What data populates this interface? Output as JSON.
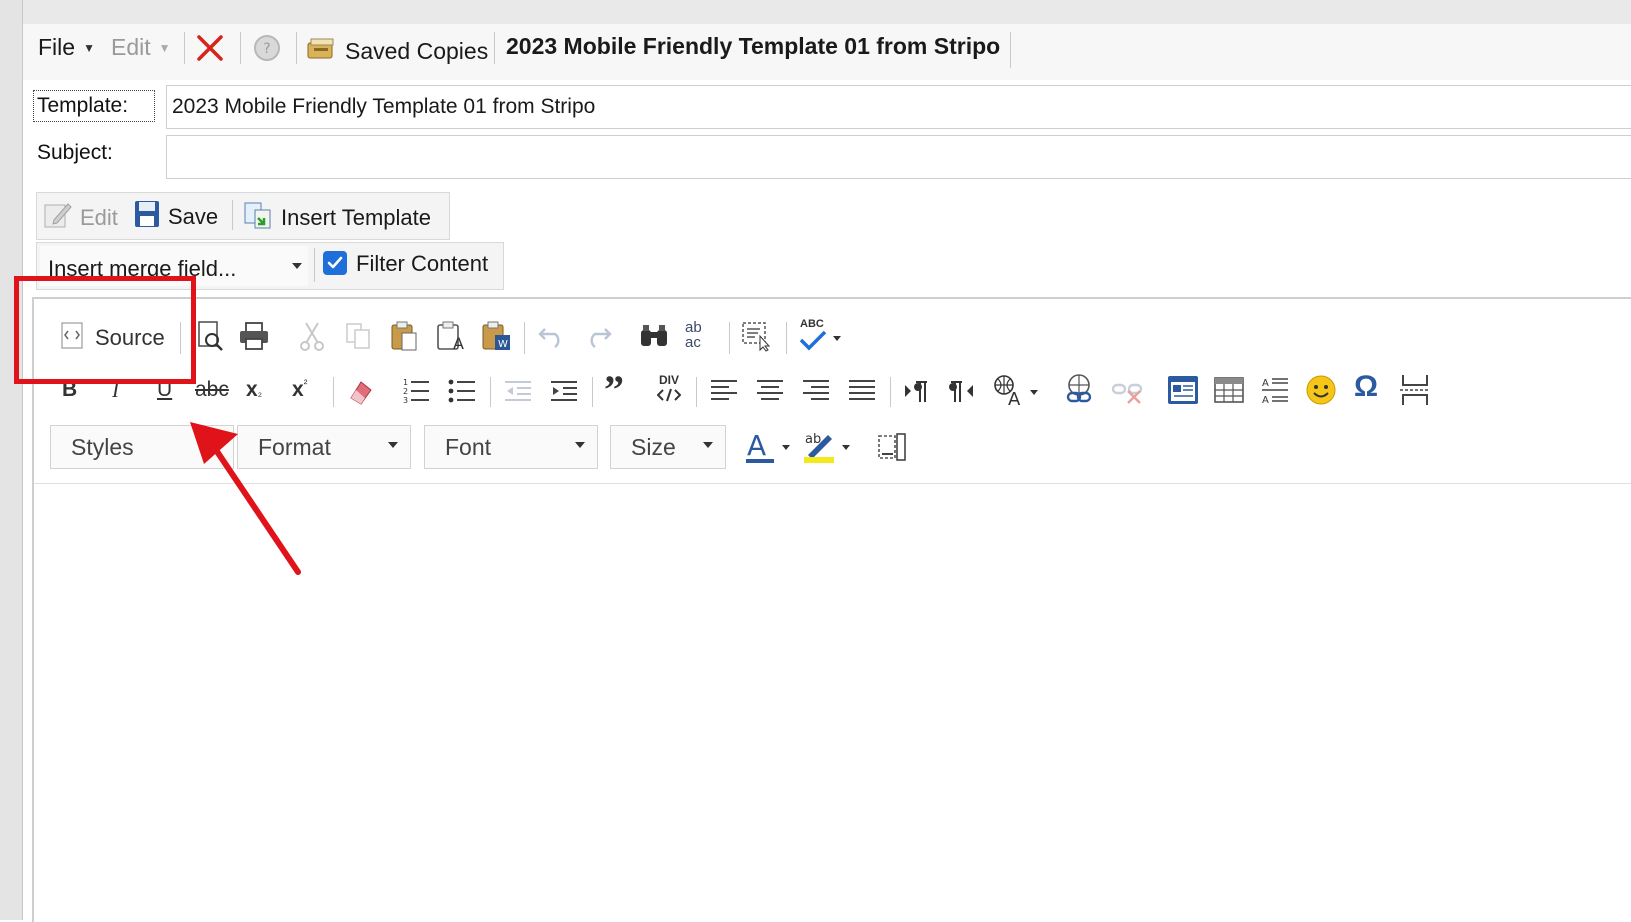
{
  "menu": {
    "file_label": "File",
    "edit_label": "Edit",
    "saved_copies_label": "Saved Copies",
    "window_title": "2023 Mobile Friendly Template 01 from Stripo"
  },
  "form": {
    "template_label": "Template:",
    "template_value": "2023 Mobile Friendly Template 01 from Stripo",
    "subject_label": "Subject:",
    "subject_value": ""
  },
  "actions": {
    "edit_label": "Edit",
    "save_label": "Save",
    "insert_template_label": "Insert Template",
    "merge_field_selected": "Insert merge field...",
    "filter_content_label": "Filter Content",
    "filter_content_checked": true
  },
  "editor_toolbar": {
    "source_label": "Source",
    "styles_label": "Styles",
    "format_label": "Format",
    "font_label": "Font",
    "size_label": "Size",
    "div_label": "DIV",
    "spell_label": "ABC",
    "text_bold": "B",
    "text_italic": "I",
    "text_underline": "U",
    "text_strike": "abc",
    "text_subscript": "x",
    "text_superscript": "x",
    "omega": "Ω",
    "find_replace_label": "ab ac"
  },
  "annotation": {
    "highlight_color": "#e0131b",
    "arrow_color": "#e0131b"
  },
  "colors": {
    "checkbox_blue": "#1e6fd9",
    "toolbar_icon": "#3b4a66"
  }
}
